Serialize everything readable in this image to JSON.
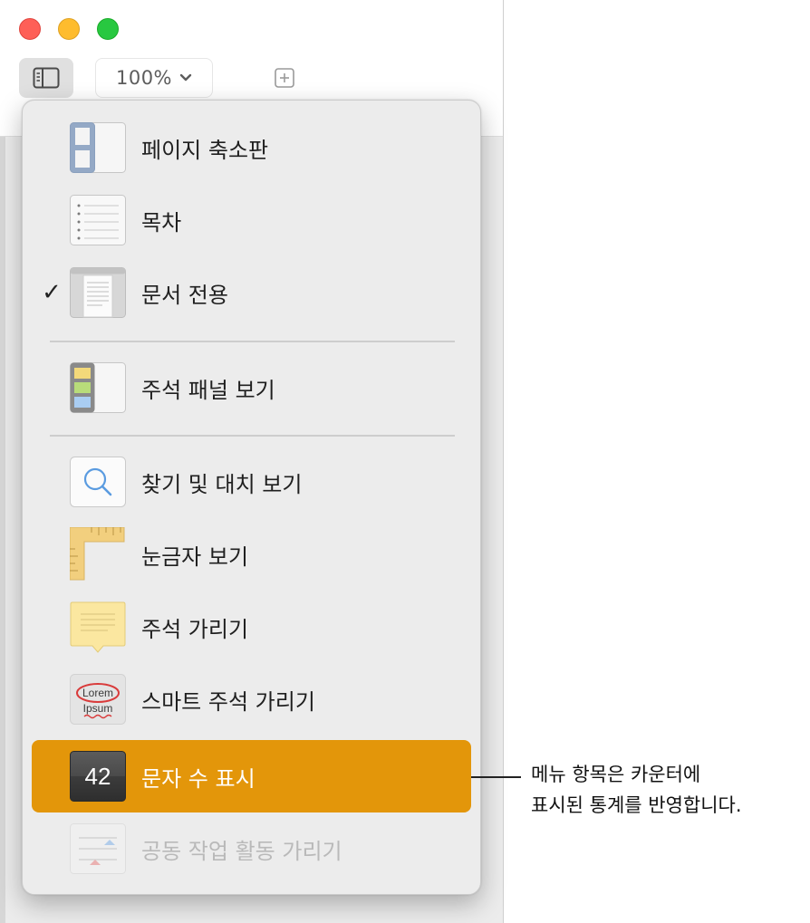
{
  "toolbar": {
    "zoom_value": "100%",
    "chevron": "⌄"
  },
  "menu": {
    "items": [
      {
        "label": "페이지 축소판",
        "icon": "page-thumbnails-icon"
      },
      {
        "label": "목차",
        "icon": "table-of-contents-icon"
      },
      {
        "label": "문서 전용",
        "icon": "document-only-icon",
        "checked": "✓"
      },
      {
        "label": "주석 패널 보기",
        "icon": "comments-pane-icon"
      },
      {
        "label": "찾기 및 대치 보기",
        "icon": "magnifier-icon"
      },
      {
        "label": "눈금자 보기",
        "icon": "ruler-icon"
      },
      {
        "label": "주석 가리기",
        "icon": "sticky-note-icon"
      },
      {
        "label": "스마트 주석 가리기",
        "icon": "smart-annotation-icon",
        "icon_text_1": "Lorem",
        "icon_text_2": "Ipsum"
      },
      {
        "label": "문자 수 표시",
        "icon": "word-count-icon",
        "icon_text": "42"
      },
      {
        "label": "공동 작업 활동 가리기",
        "icon": "collaboration-activity-icon"
      }
    ]
  },
  "callout": {
    "line1": "메뉴 항목은 카운터에",
    "line2": "표시된 통계를 반영합니다."
  },
  "colors": {
    "highlight": "#e3960a",
    "close": "#fe5f57",
    "minimize": "#febc2e",
    "zoom": "#28c840"
  }
}
